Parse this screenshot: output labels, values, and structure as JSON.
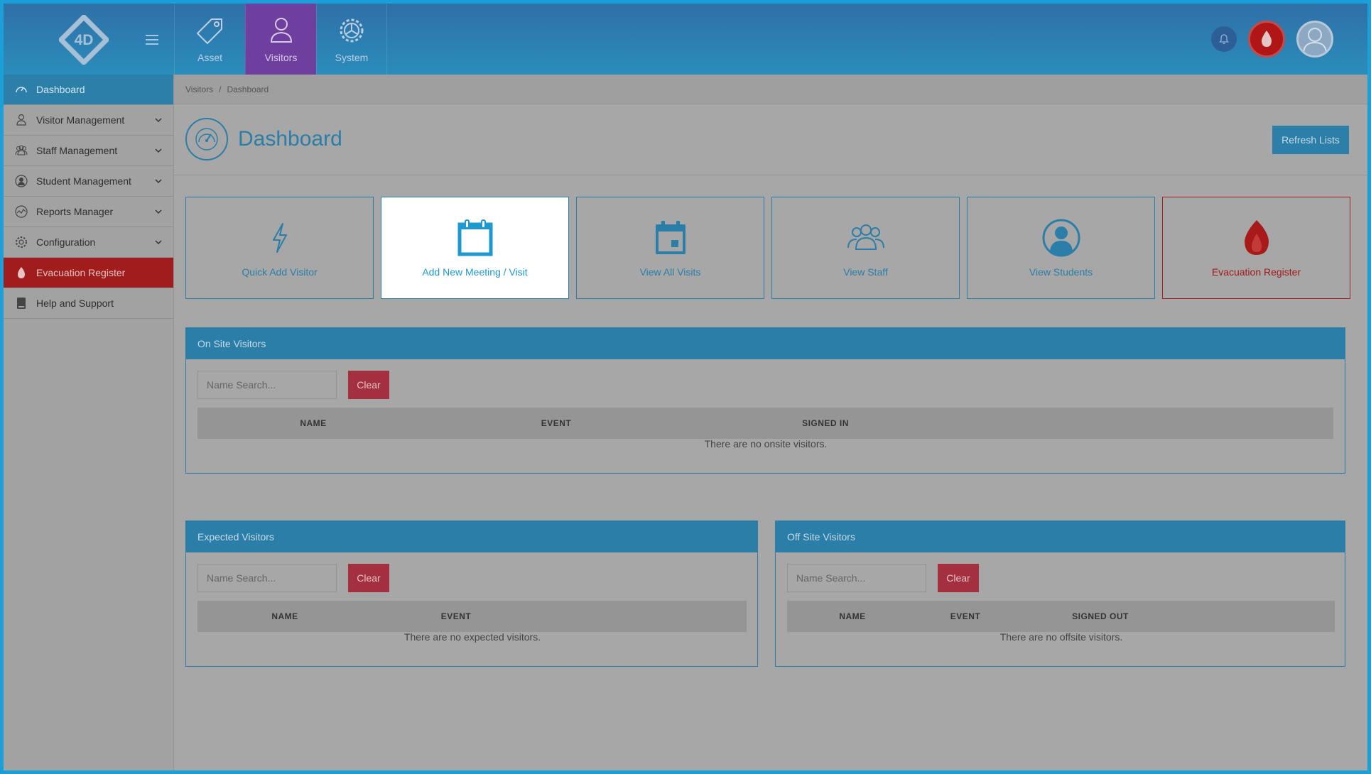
{
  "topbar": {
    "logo_text": "4D",
    "modules": [
      {
        "label": "Asset",
        "icon": "tag-icon"
      },
      {
        "label": "Visitors",
        "icon": "person-icon",
        "active": true
      },
      {
        "label": "System",
        "icon": "gear-icon"
      }
    ],
    "right_icons": [
      "bell-icon",
      "fire-icon",
      "user-avatar-icon"
    ]
  },
  "sidebar": {
    "items": [
      {
        "label": "Dashboard",
        "icon": "speedometer-icon",
        "active": true
      },
      {
        "label": "Visitor Management",
        "icon": "person-icon",
        "expandable": true
      },
      {
        "label": "Staff Management",
        "icon": "group-icon",
        "expandable": true
      },
      {
        "label": "Student Management",
        "icon": "student-icon",
        "expandable": true
      },
      {
        "label": "Reports Manager",
        "icon": "chart-icon",
        "expandable": true
      },
      {
        "label": "Configuration",
        "icon": "gear-icon",
        "expandable": true
      },
      {
        "label": "Evacuation Register",
        "icon": "fire-icon"
      },
      {
        "label": "Help and Support",
        "icon": "book-icon"
      }
    ]
  },
  "breadcrumb": {
    "items": [
      "Visitors",
      "Dashboard"
    ],
    "separator": "/"
  },
  "page": {
    "title": "Dashboard",
    "refresh_label": "Refresh Lists"
  },
  "tiles": [
    {
      "label": "Quick Add Visitor",
      "icon": "lightning-icon"
    },
    {
      "label": "Add New Meeting / Visit",
      "icon": "calendar-icon"
    },
    {
      "label": "View All Visits",
      "icon": "calendar-event-icon"
    },
    {
      "label": "View Staff",
      "icon": "group-icon"
    },
    {
      "label": "View Students",
      "icon": "student-icon"
    },
    {
      "label": "Evacuation Register",
      "icon": "fire-icon"
    }
  ],
  "onsite": {
    "title": "On Site Visitors",
    "search_placeholder": "Name Search...",
    "clear_label": "Clear",
    "columns": [
      "NAME",
      "EVENT",
      "SIGNED IN"
    ],
    "empty": "There are no onsite visitors."
  },
  "expected": {
    "title": "Expected Visitors",
    "search_placeholder": "Name Search...",
    "clear_label": "Clear",
    "columns": [
      "NAME",
      "EVENT"
    ],
    "empty": "There are no expected visitors."
  },
  "offsite": {
    "title": "Off Site Visitors",
    "search_placeholder": "Name Search...",
    "clear_label": "Clear",
    "columns": [
      "NAME",
      "EVENT",
      "SIGNED OUT"
    ],
    "empty": "There are no offsite visitors."
  },
  "colors": {
    "primary": "#2a7ea8",
    "module_active": "#6f3fa0",
    "danger": "#a11c1c",
    "clear_button": "#a4303f",
    "highlight_tile": "#ffffff"
  }
}
